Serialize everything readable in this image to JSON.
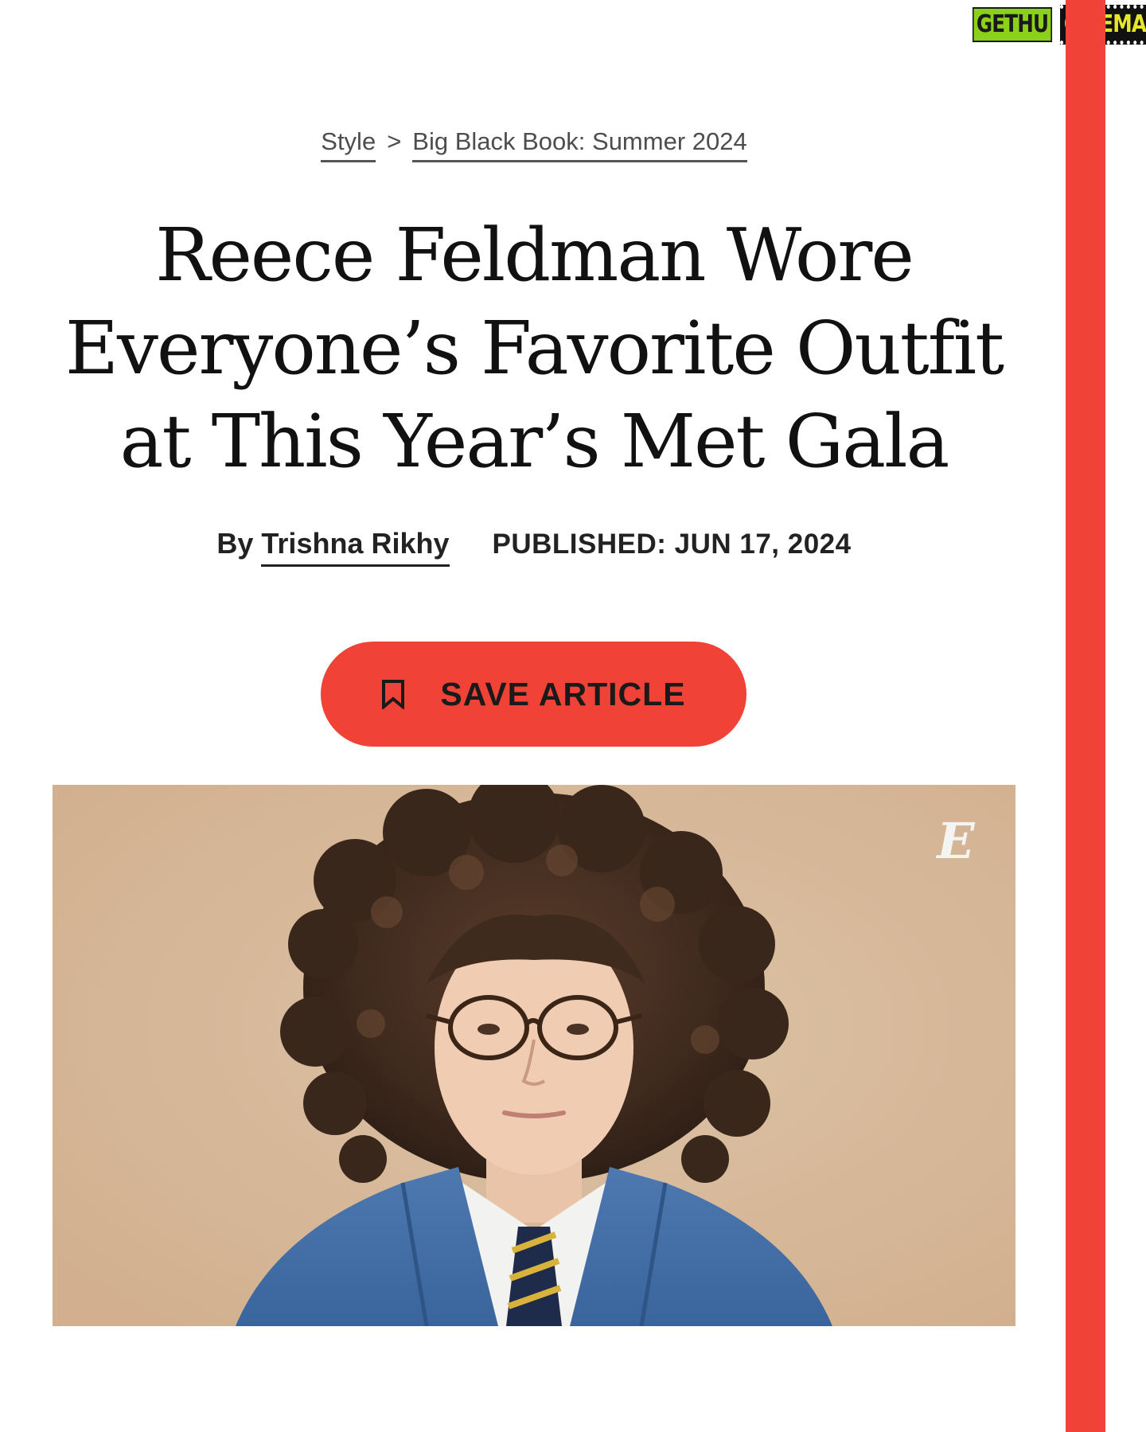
{
  "watermark": {
    "left": "GETHU",
    "right": "CINEMA"
  },
  "breadcrumb": {
    "section": "Style",
    "separator": ">",
    "subsection": "Big Black Book: Summer 2024"
  },
  "article": {
    "headline_lines": [
      "Reece Feldman Wore",
      "Everyone’s Favorite Outfit",
      "at This Year’s Met Gala"
    ],
    "by_prefix": "By",
    "author": "Trishna Rikhy",
    "published": "PUBLISHED: JUN 17, 2024"
  },
  "save_button": {
    "label": "SAVE ARTICLE",
    "icon": "bookmark-icon"
  },
  "hero_image": {
    "logo_letter": "E"
  },
  "colors": {
    "accent": "#f04236",
    "text": "#111111",
    "meta": "#4d4d4d",
    "photo_bg": "#d6b697"
  }
}
